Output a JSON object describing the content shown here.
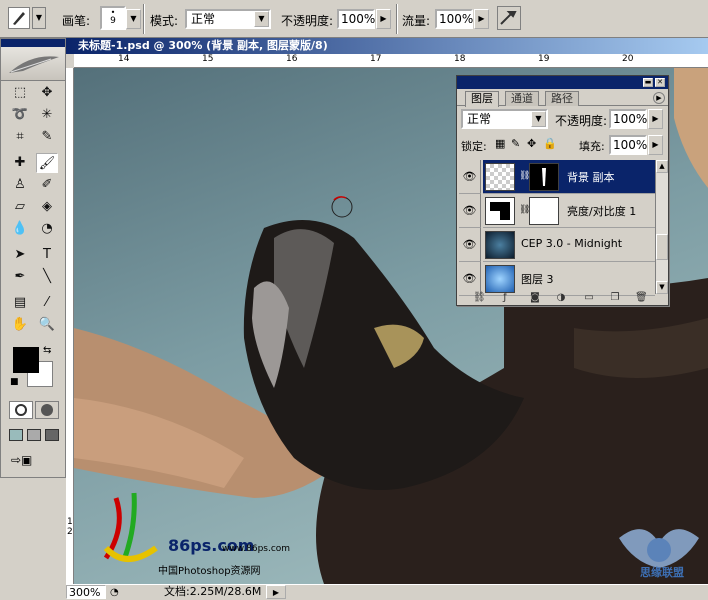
{
  "options_bar": {
    "brush_label": "画笔:",
    "brush_size": "9",
    "mode_label": "模式:",
    "mode_value": "正常",
    "opacity_label": "不透明度:",
    "opacity_value": "100%",
    "flow_label": "流量:",
    "flow_value": "100%"
  },
  "document": {
    "title": "未标题-1.psd @ 300% (背景 副本, 图层蒙版/8)",
    "ruler_ticks": [
      "14",
      "15",
      "16",
      "17",
      "18",
      "19",
      "20"
    ],
    "vruler_ticks": [
      "1",
      "2"
    ],
    "zoom": "300%",
    "doc_info": "文档:2.25M/28.6M"
  },
  "layers_panel": {
    "tabs": [
      "图层",
      "通道",
      "路径"
    ],
    "blend_mode": "正常",
    "opacity_label": "不透明度:",
    "opacity_value": "100%",
    "lock_label": "锁定:",
    "fill_label": "填充:",
    "fill_value": "100%",
    "layers": [
      {
        "name": "背景 副本",
        "selected": true
      },
      {
        "name": "亮度/对比度 1",
        "selected": false
      },
      {
        "name": "CEP 3.0 - Midnight",
        "selected": false
      },
      {
        "name": "图层 3",
        "selected": false
      }
    ]
  },
  "watermark": {
    "brand": "86ps.com",
    "url": "www.86ps.com",
    "caption": "中国Photoshop资源网",
    "badge": "思缘联盟"
  },
  "colors": {
    "title_bar": "#0a246a",
    "chrome": "#d4d0c8",
    "foreground_swatch": "#000000",
    "background_swatch": "#ffffff"
  }
}
